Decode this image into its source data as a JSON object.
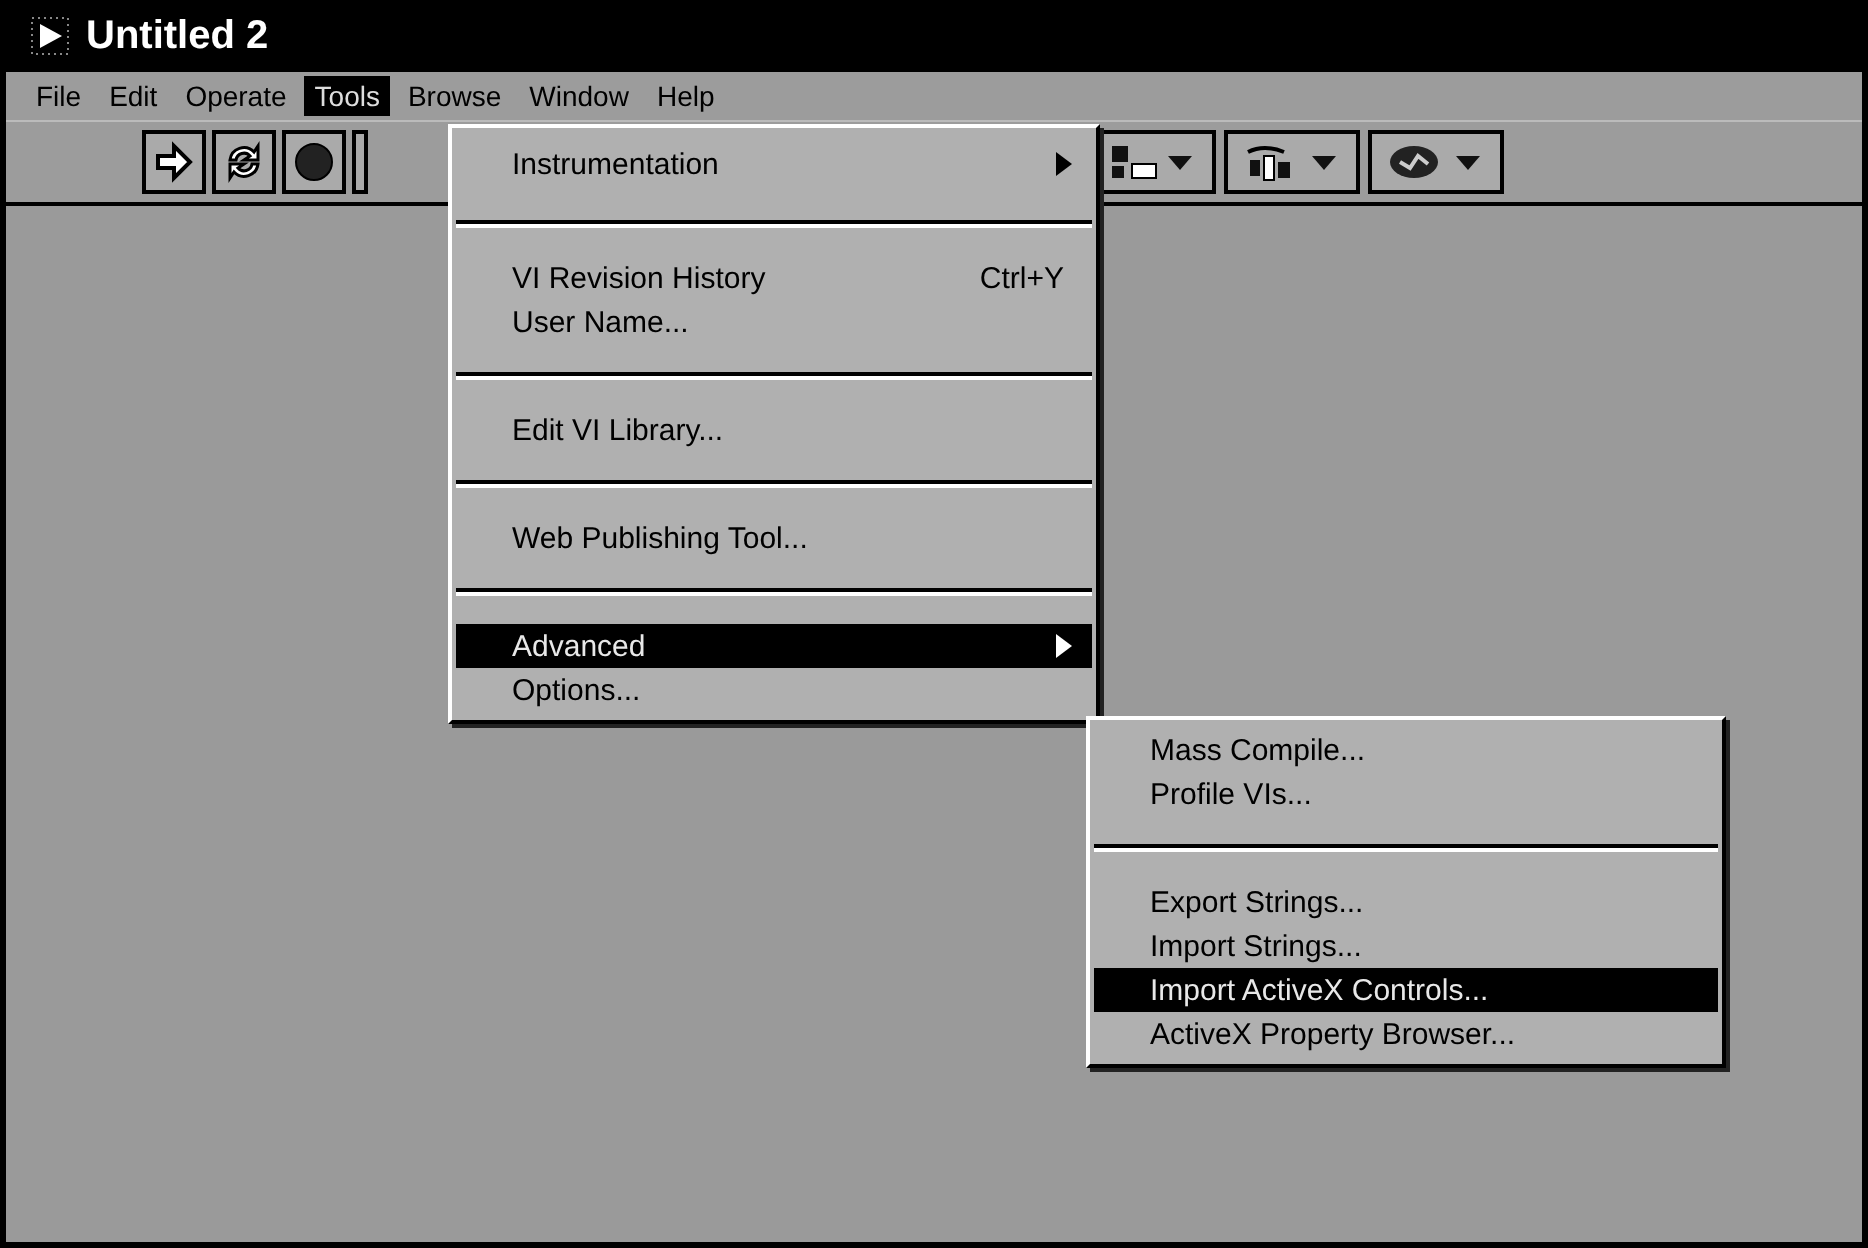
{
  "window": {
    "title": "Untitled 2"
  },
  "menubar": [
    {
      "label": "File",
      "selected": false
    },
    {
      "label": "Edit",
      "selected": false
    },
    {
      "label": "Operate",
      "selected": false
    },
    {
      "label": "Tools",
      "selected": true
    },
    {
      "label": "Browse",
      "selected": false
    },
    {
      "label": "Window",
      "selected": false
    },
    {
      "label": "Help",
      "selected": false
    }
  ],
  "tools_menu": [
    {
      "kind": "item",
      "label": "Instrumentation",
      "submenu": true,
      "selected": false
    },
    {
      "kind": "separator"
    },
    {
      "kind": "item",
      "label": "VI Revision History",
      "shortcut": "Ctrl+Y",
      "selected": false
    },
    {
      "kind": "item",
      "label": "User Name...",
      "selected": false
    },
    {
      "kind": "separator"
    },
    {
      "kind": "item",
      "label": "Edit VI Library...",
      "selected": false
    },
    {
      "kind": "separator"
    },
    {
      "kind": "item",
      "label": "Web Publishing Tool...",
      "selected": false
    },
    {
      "kind": "separator"
    },
    {
      "kind": "item",
      "label": "Advanced",
      "submenu": true,
      "selected": true
    },
    {
      "kind": "item",
      "label": "Options...",
      "selected": false
    }
  ],
  "advanced_menu": [
    {
      "kind": "item",
      "label": "Mass Compile...",
      "selected": false
    },
    {
      "kind": "item",
      "label": "Profile VIs...",
      "selected": false
    },
    {
      "kind": "separator"
    },
    {
      "kind": "item",
      "label": "Export Strings...",
      "selected": false
    },
    {
      "kind": "item",
      "label": "Import Strings...",
      "selected": false
    },
    {
      "kind": "item",
      "label": "Import ActiveX Controls...",
      "selected": true
    },
    {
      "kind": "item",
      "label": "ActiveX Property Browser...",
      "selected": false
    }
  ]
}
